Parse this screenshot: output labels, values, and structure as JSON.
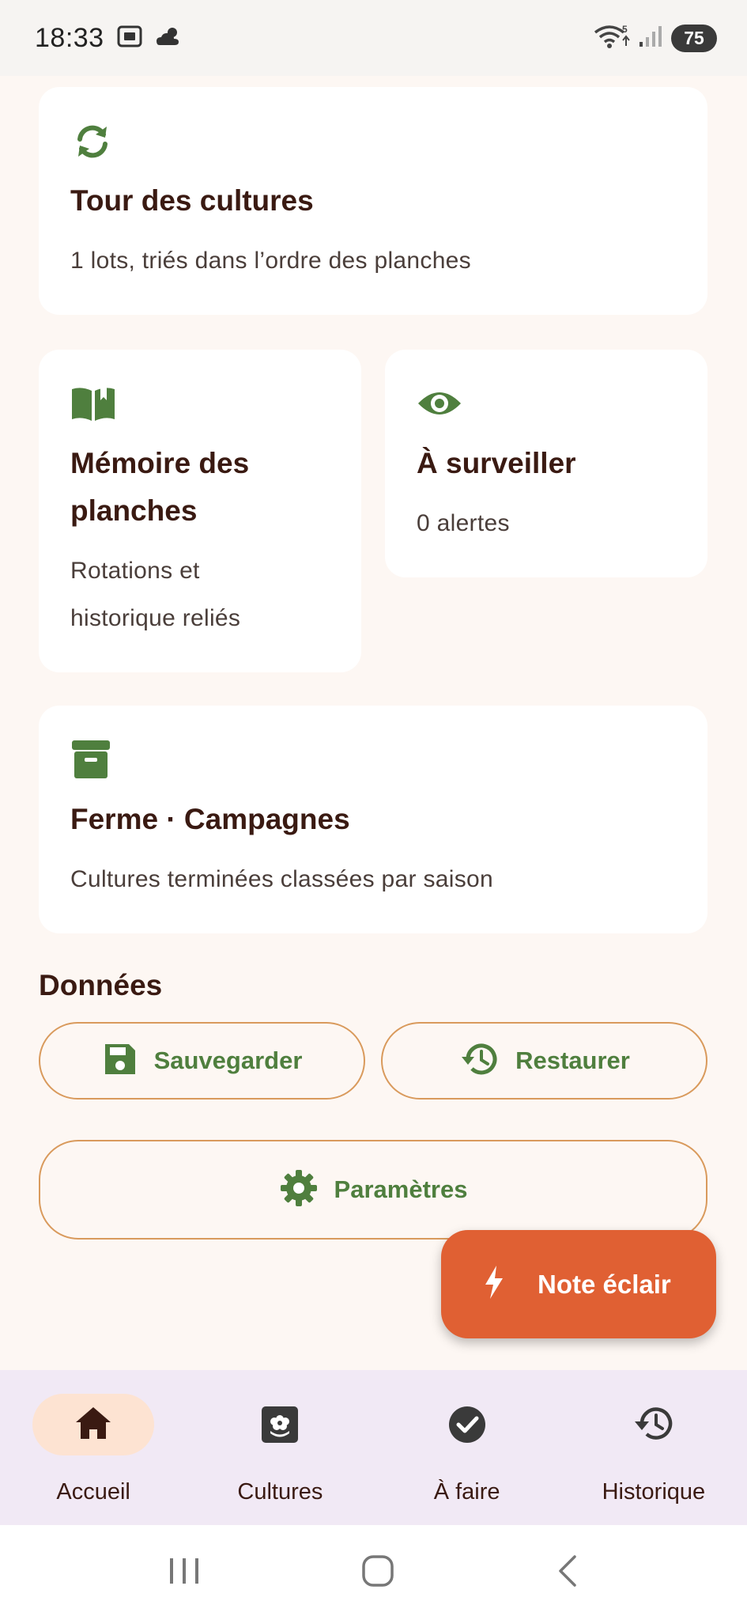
{
  "status_bar": {
    "time": "18:33",
    "battery": "75",
    "wifi_badge": "5"
  },
  "cards": {
    "tour": {
      "title": "Tour des cultures",
      "subtitle": "1 lots, triés dans l’ordre des planches",
      "icon": "sync-icon"
    },
    "memoire": {
      "title_line1": "Mémoire des",
      "title_line2": "planches",
      "subtitle_line1": "Rotations et",
      "subtitle_line2": "historique reliés",
      "icon": "open-book-icon"
    },
    "surveiller": {
      "title": "À surveiller",
      "subtitle": "0 alertes",
      "icon": "eye-icon"
    },
    "ferme": {
      "title": "Ferme · Campagnes",
      "subtitle": "Cultures terminées classées par saison",
      "icon": "archive-box-icon"
    }
  },
  "donnees": {
    "title": "Données",
    "save_label": "Sauvegarder",
    "restore_label": "Restaurer",
    "settings_label": "Paramètres"
  },
  "fab": {
    "label": "Note éclair",
    "icon": "lightning-bolt-icon"
  },
  "bottom_nav": {
    "items": [
      {
        "label": "Accueil",
        "icon": "home-icon",
        "active": true
      },
      {
        "label": "Cultures",
        "icon": "plant-icon",
        "active": false
      },
      {
        "label": "À faire",
        "icon": "check-circle-icon",
        "active": false
      },
      {
        "label": "Historique",
        "icon": "history-icon",
        "active": false
      }
    ]
  },
  "colors": {
    "accent_green": "#4f7f3e",
    "outline_orange": "#d99a5c",
    "fab_orange": "#e06033",
    "text_dark": "#3a1a12",
    "nav_bg": "#f1e9f5",
    "active_pill": "#fde3d2"
  }
}
